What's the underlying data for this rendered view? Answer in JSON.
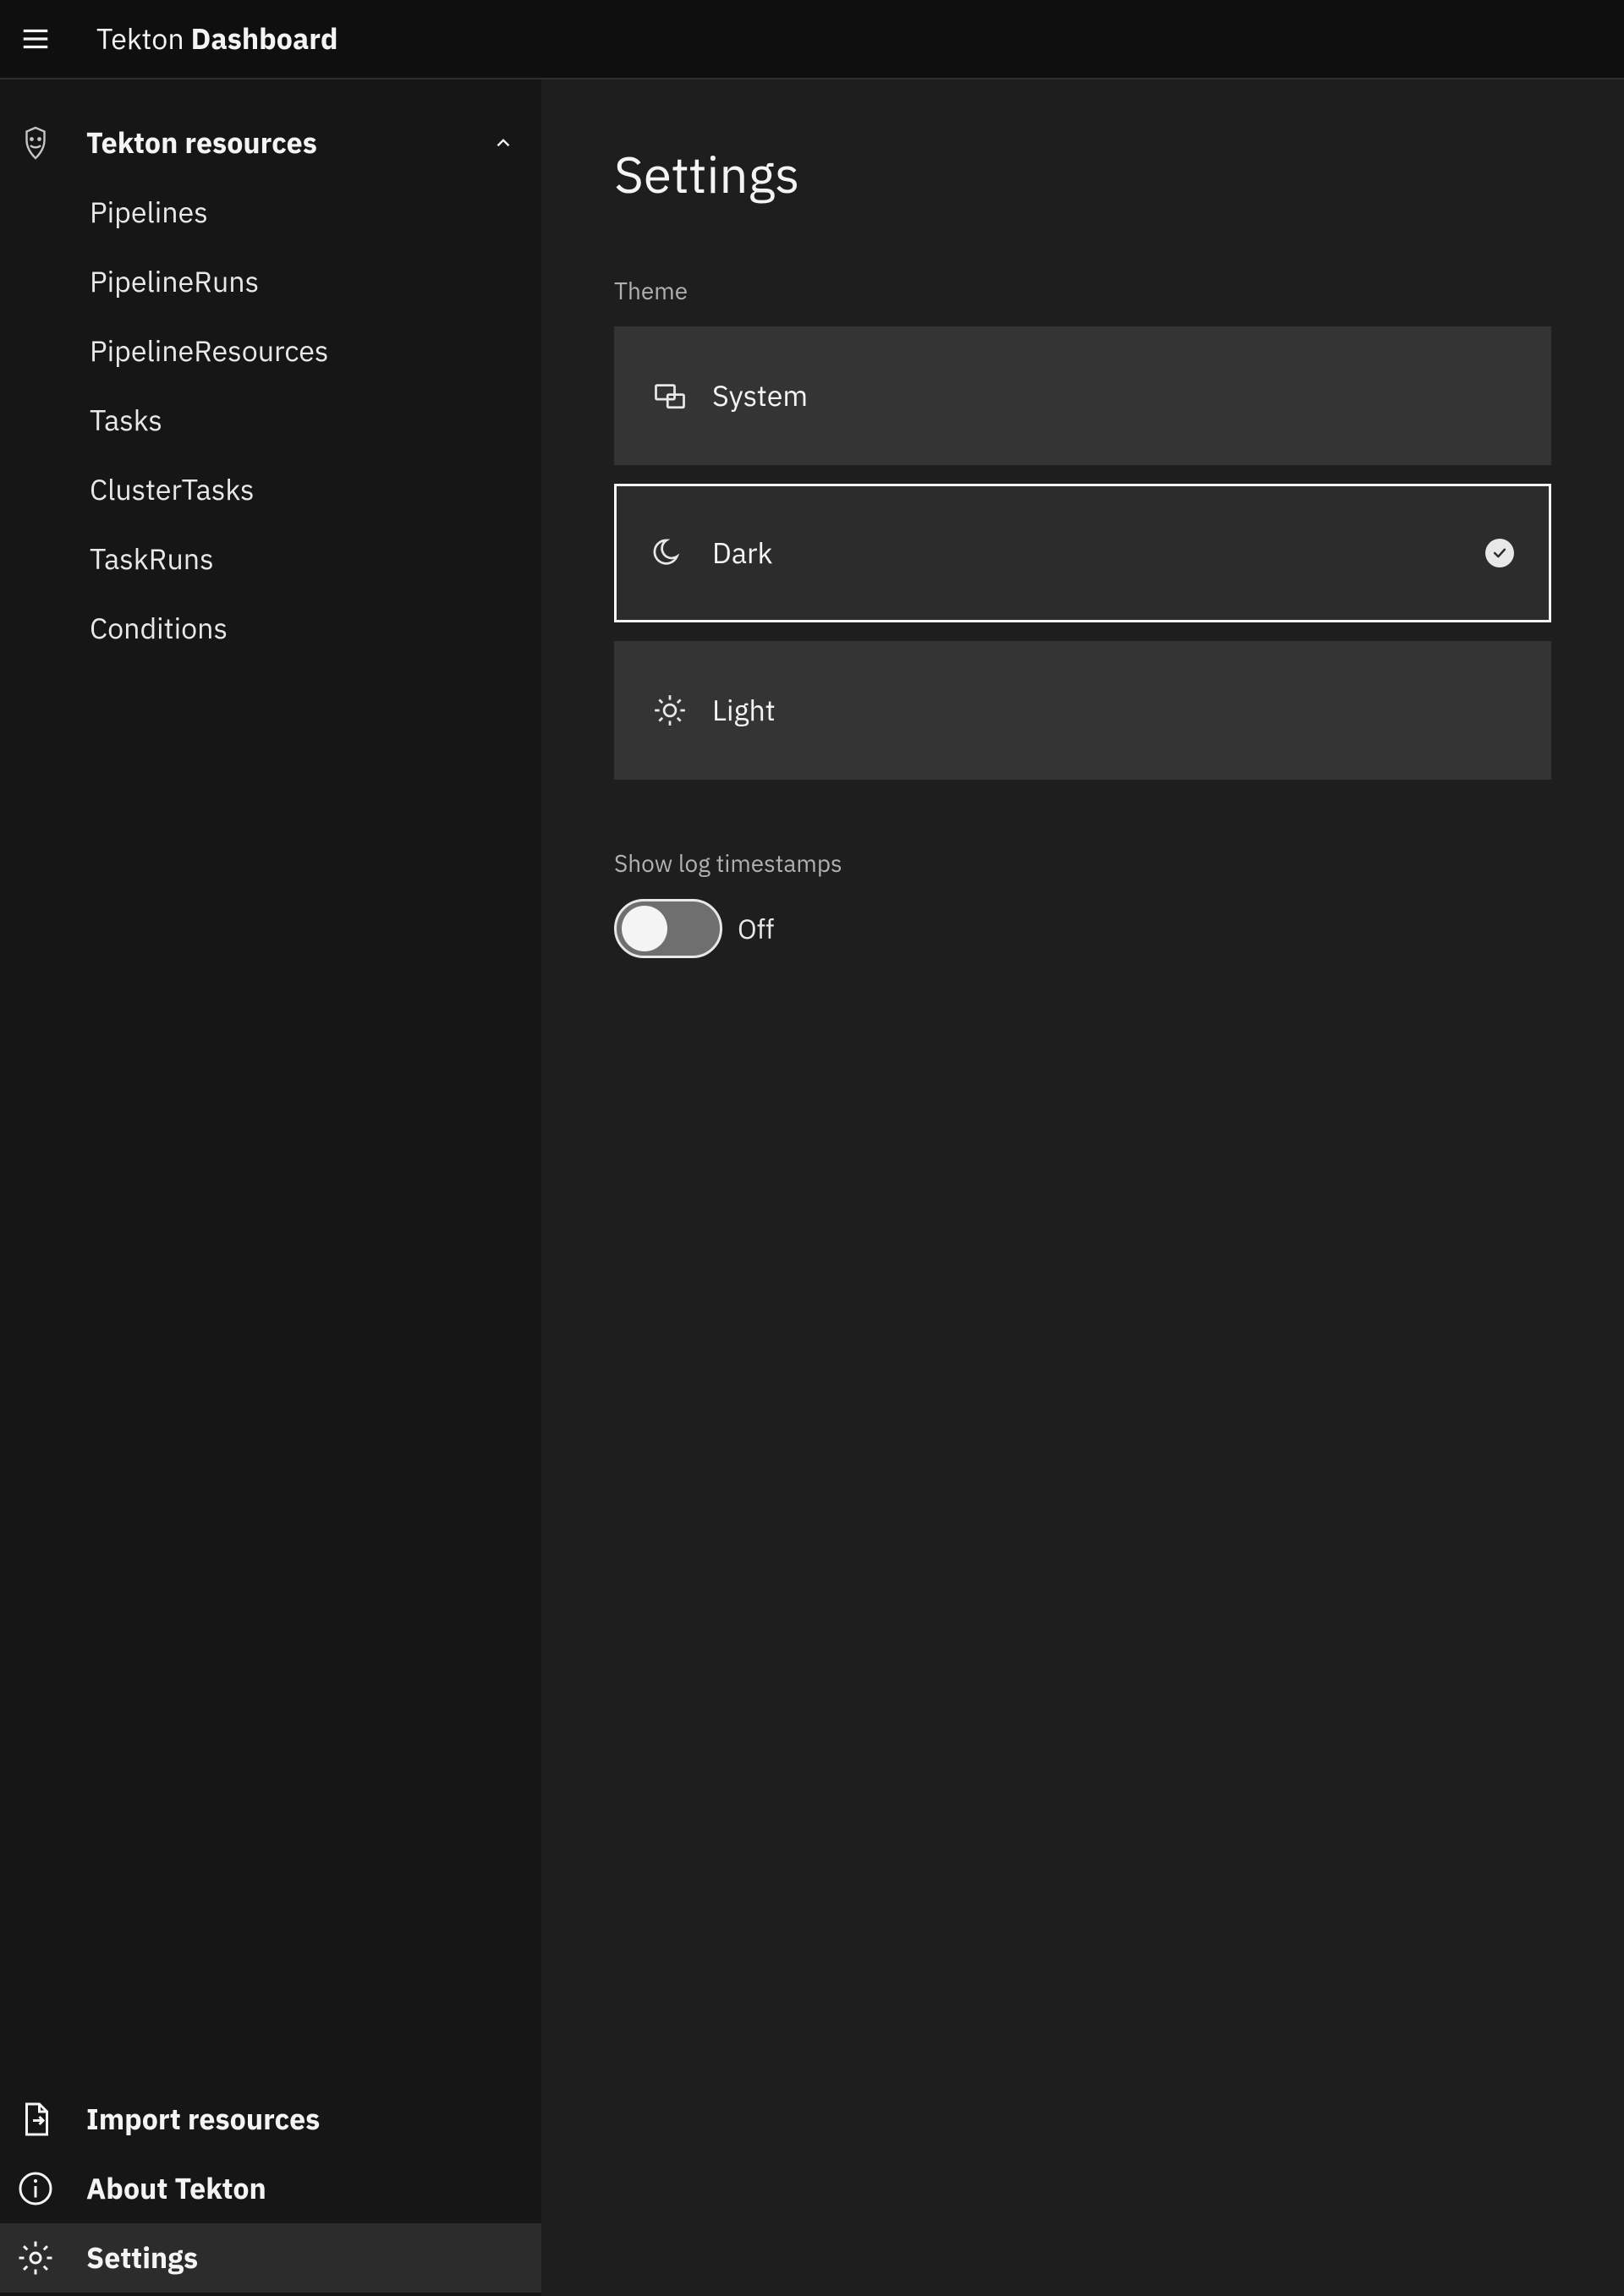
{
  "header": {
    "brand_prefix": "Tekton",
    "brand_suffix": "Dashboard"
  },
  "sidebar": {
    "section_label": "Tekton resources",
    "items": [
      {
        "label": "Pipelines"
      },
      {
        "label": "PipelineRuns"
      },
      {
        "label": "PipelineResources"
      },
      {
        "label": "Tasks"
      },
      {
        "label": "ClusterTasks"
      },
      {
        "label": "TaskRuns"
      },
      {
        "label": "Conditions"
      }
    ],
    "bottom": {
      "import_label": "Import resources",
      "about_label": "About Tekton",
      "settings_label": "Settings"
    }
  },
  "main": {
    "title": "Settings",
    "theme_label": "Theme",
    "themes": {
      "system": "System",
      "dark": "Dark",
      "light": "Light",
      "selected": "dark"
    },
    "logs": {
      "label": "Show log timestamps",
      "state_text": "Off",
      "enabled": false
    }
  }
}
